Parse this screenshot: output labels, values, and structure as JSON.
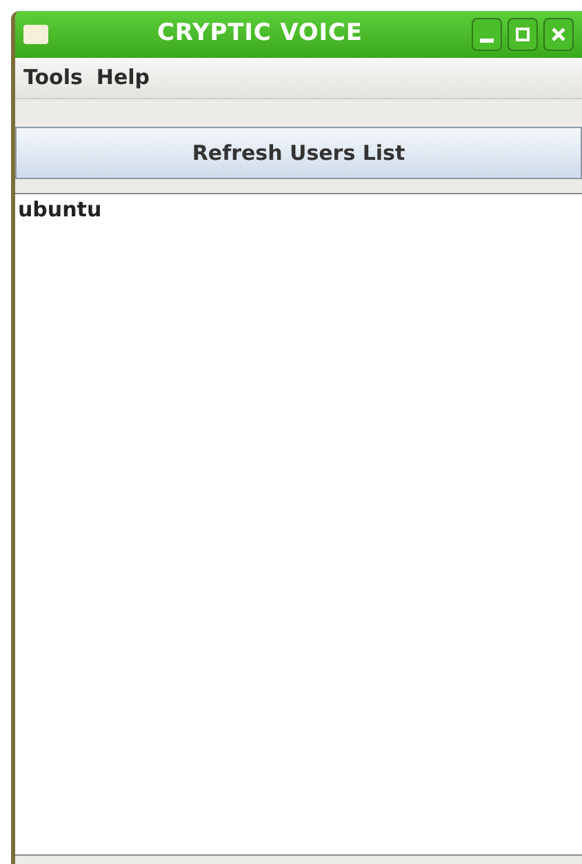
{
  "window": {
    "title": "CRYPTIC VOICE"
  },
  "menu": [
    "Tools",
    "Help"
  ],
  "refresh_button": {
    "label": "Refresh Users List"
  },
  "users": [
    {
      "name": "ubuntu",
      "selected": false
    }
  ]
}
